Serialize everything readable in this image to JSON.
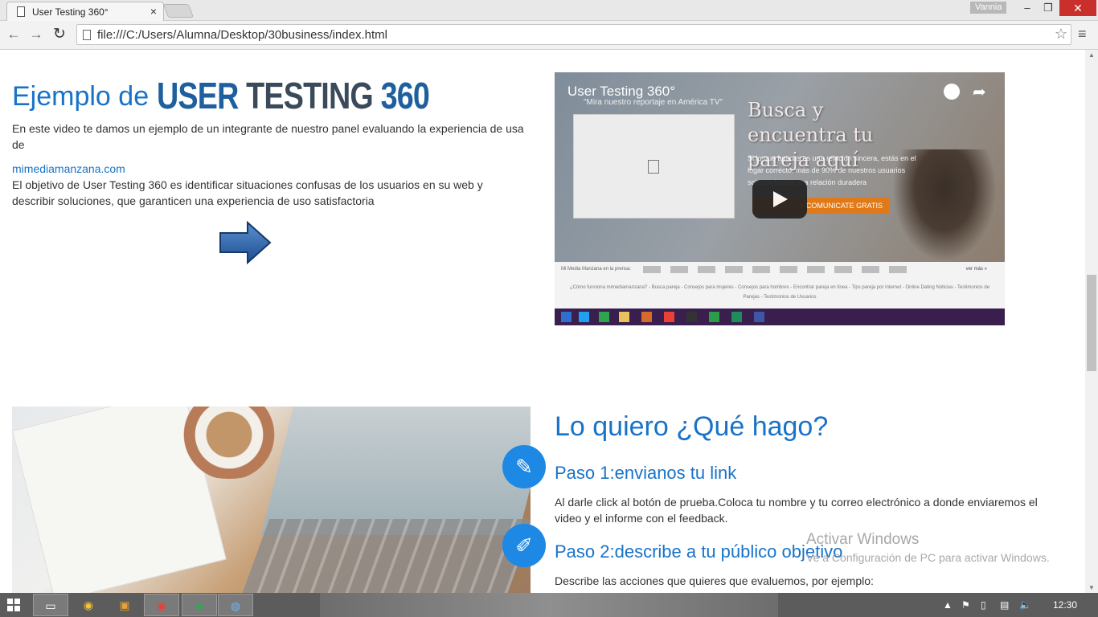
{
  "browser": {
    "tab_title": "User Testing 360°",
    "tab_close": "×",
    "user_name": "Vannia",
    "minimize": "–",
    "restore": "❐",
    "close": "✕",
    "back": "←",
    "forward": "→",
    "reload": "↻",
    "url": "file:///C:/Users/Alumna/Desktop/30business/index.html",
    "bookmark": "☆",
    "menu": "≡"
  },
  "section1": {
    "title_prefix": "Ejemplo de ",
    "brand_a": "USER",
    "brand_b": "TESTING",
    "brand_c": "360",
    "intro": "En este video te damos un ejemplo de un integrante de nuestro panel evaluando la experiencia de usa de",
    "link": "mimediamanzana.com",
    "body": "El objetivo de User Testing 360 es identificar situaciones confusas de los usuarios en su web y describir soluciones, que garanticen una experiencia de uso satisfactoria"
  },
  "video": {
    "title": "User Testing 360°",
    "tv_caption": "\"Mira nuestro reportaje en América TV\"",
    "promo_heading": "Busca y encuentra tu pareja aquí",
    "promo_text": "Si lo que buscas es una relación sincera, estás en el lugar correcto: más de 90% de nuestros usuarios solteros busca una relación duradera",
    "promo_button": "Y COMUNICATE GRATIS",
    "press_label": "Mi Media Manzana en la prensa:",
    "see_more": "ver más »",
    "faq": "¿Cómo funciona mimediamanzana? - Busca pareja - Consejos para mujeres - Consejos para hombres - Encontrar pareja en línea - Tips pareja por internet - Online Dating Noticias - Testimonios de Parejas - Testimonios de Usuarios"
  },
  "section2": {
    "heading": "Lo quiero ¿Qué hago?",
    "step1_title": "Paso 1:envianos tu link",
    "step1_text": "Al darle click al botón de prueba.Coloca tu nombre y tu correo electrónico a donde enviaremos el video y el informe con el feedback.",
    "step2_title": "Paso 2:describe a tu público objetivo",
    "step2_text": "Describe las acciones que quieres que evaluemos, por ejemplo:",
    "step1_icon": "pencil-icon",
    "step2_icon": "pencil-ruler-icon"
  },
  "watermark": {
    "title": "Activar Windows",
    "subtitle": "Ve a Configuración de PC para activar Windows."
  },
  "taskbar": {
    "time": "12:30"
  },
  "colors": {
    "accent": "#1873c8",
    "badge": "#1e88e5"
  }
}
